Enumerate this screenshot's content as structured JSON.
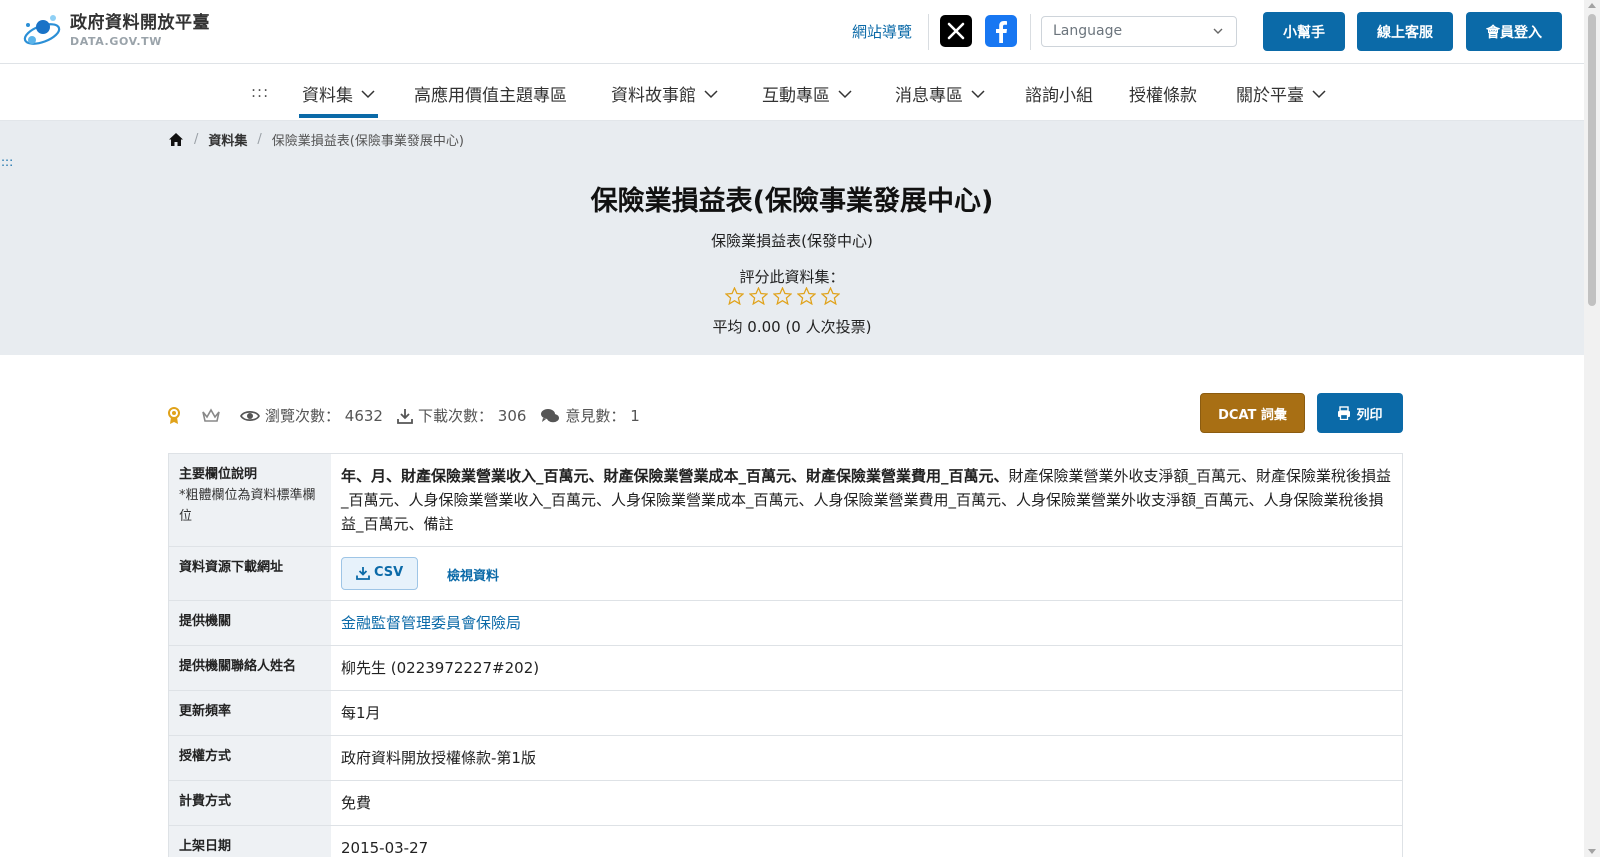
{
  "header": {
    "logo": {
      "title_cn": "政府資料開放平臺",
      "title_en": "DATA.GOV.TW"
    },
    "sitemap_label": "網站導覽",
    "social": [
      {
        "icon": "x-twitter-icon"
      },
      {
        "icon": "facebook-icon"
      }
    ],
    "language": {
      "placeholder": "Language"
    },
    "buttons": {
      "helper": "小幫手",
      "support": "線上客服",
      "login": "會員登入"
    }
  },
  "nav": {
    "accesskey": ":::",
    "items": [
      {
        "label": "資料集",
        "has_dropdown": true,
        "active": true
      },
      {
        "label": "高應用價值主題專區",
        "has_dropdown": false
      },
      {
        "label": "資料故事館",
        "has_dropdown": true
      },
      {
        "label": "互動專區",
        "has_dropdown": true
      },
      {
        "label": "消息專區",
        "has_dropdown": true
      },
      {
        "label": "諮詢小組",
        "has_dropdown": false
      },
      {
        "label": "授權條款",
        "has_dropdown": false
      },
      {
        "label": "關於平臺",
        "has_dropdown": true
      }
    ]
  },
  "breadcrumb": {
    "home_icon": "home-icon",
    "items": [
      "資料集",
      "保險業損益表(保險事業發展中心)"
    ]
  },
  "hero": {
    "accesskey": ":::",
    "title": "保險業損益表(保險事業發展中心)",
    "subtitle": "保險業損益表(保發中心)",
    "rating_label": "評分此資料集：",
    "rating": {
      "score": 0,
      "max": 5
    },
    "average_text": "平均 0.00 (0 人次投票)"
  },
  "stats": {
    "badge_icons": [
      "award-icon",
      "crown-icon"
    ],
    "views_label": "瀏覽次數：",
    "views": "4632",
    "downloads_label": "下載次數：",
    "downloads": "306",
    "comments_label": "意見數：",
    "comments": "1"
  },
  "actions": {
    "dcat": "DCAT 詞彙",
    "print": "列印"
  },
  "details": {
    "main_fields": {
      "label": "主要欄位說明",
      "note": "*粗體欄位為資料標準欄位",
      "bold_fields": "年、月、財產保險業營業收入_百萬元、財產保險業營業成本_百萬元、財產保險業營業費用_百萬元、",
      "other_fields": "財產保險業營業外收支淨額_百萬元、財產保險業稅後損益_百萬元、人身保險業營業收入_百萬元、人身保險業營業成本_百萬元、人身保險業營業費用_百萬元、人身保險業營業外收支淨額_百萬元、人身保險業稅後損益_百萬元、備註"
    },
    "download": {
      "label": "資料資源下載網址",
      "csv": "CSV",
      "view": "檢視資料"
    },
    "provider": {
      "label": "提供機關",
      "value": "金融監督管理委員會保險局"
    },
    "contact": {
      "label": "提供機關聯絡人姓名",
      "value": "柳先生 (0223972227#202)"
    },
    "frequency": {
      "label": "更新頻率",
      "value": "每1月"
    },
    "license": {
      "label": "授權方式",
      "value": "政府資料開放授權條款-第1版"
    },
    "fee": {
      "label": "計費方式",
      "value": "免費"
    },
    "published": {
      "label": "上架日期",
      "value": "2015-03-27"
    }
  },
  "colors": {
    "primary": "#0b6aa8",
    "dcat": "#a86f14",
    "hero_bg": "#e8ecf0",
    "star": "#e0a21a"
  }
}
